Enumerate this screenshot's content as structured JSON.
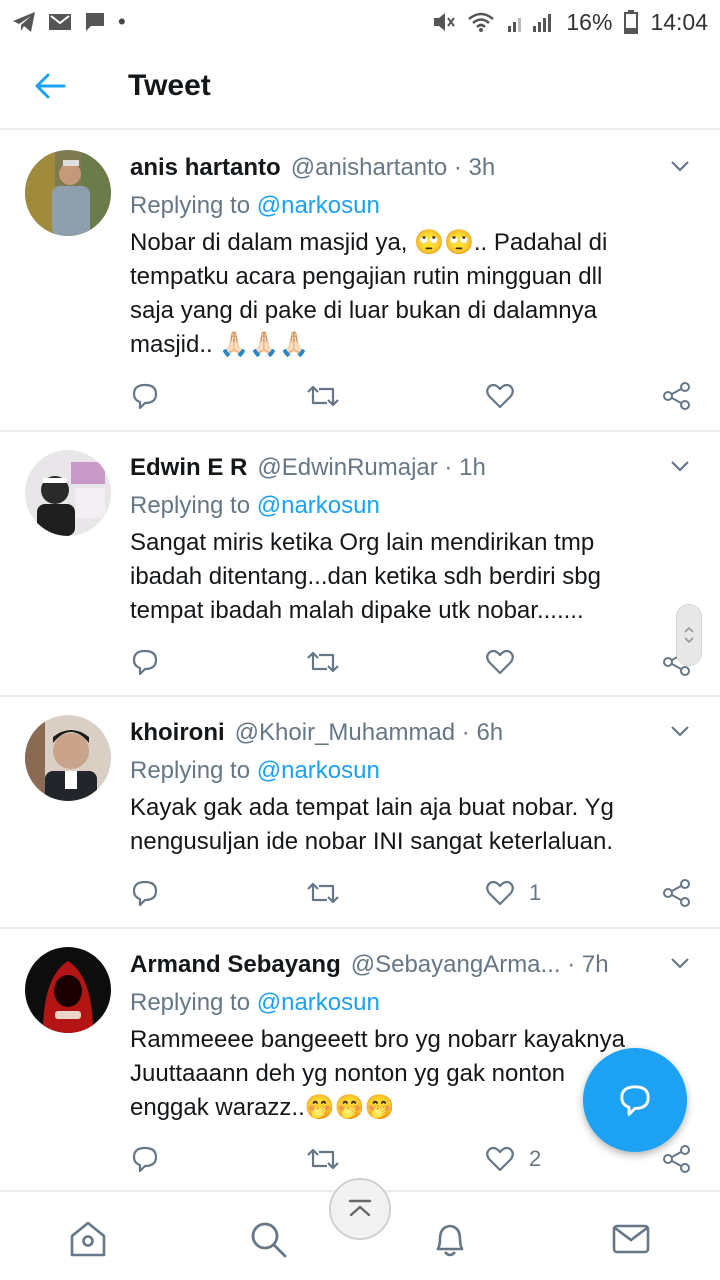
{
  "status_bar": {
    "battery": "16%",
    "time": "14:04"
  },
  "header": {
    "title": "Tweet"
  },
  "tweets": [
    {
      "name": "anis hartanto",
      "handle": "@anishartanto",
      "time": "3h",
      "replying_label": "Replying to",
      "replying_to": "@narkosun",
      "lines": [
        "Nobar di dalam masjid ya, 🙄🙄.. Padahal di",
        "tempatku acara pengajian rutin mingguan dll",
        "saja yang di pake di luar bukan di dalamnya",
        "masjid.. 🙏🏻🙏🏻🙏🏻"
      ],
      "like_count": ""
    },
    {
      "name": "Edwin E R",
      "handle": "@EdwinRumajar",
      "time": "1h",
      "replying_label": "Replying to",
      "replying_to": "@narkosun",
      "lines": [
        "Sangat miris ketika Org lain mendirikan tmp",
        "ibadah ditentang...dan ketika sdh berdiri sbg",
        "tempat ibadah malah dipake utk nobar......."
      ],
      "like_count": ""
    },
    {
      "name": "khoironi",
      "handle": "@Khoir_Muhammad",
      "time": "6h",
      "replying_label": "Replying to",
      "replying_to": "@narkosun",
      "lines": [
        "Kayak gak ada tempat lain aja buat nobar. Yg",
        "nengusuljan ide nobar INI sangat keterlaluan."
      ],
      "like_count": "1"
    },
    {
      "name": "Armand Sebayang",
      "handle": "@SebayangArma...",
      "time": "7h",
      "replying_label": "Replying to",
      "replying_to": "@narkosun",
      "lines": [
        "Rammeeee bangeeett bro yg nobarr kayaknya",
        "Juuttaaann deh yg nonton yg gak nonton",
        "enggak warazz..🤭🤭🤭"
      ],
      "like_count": "2"
    }
  ],
  "nav": [
    "home-icon",
    "search-icon",
    "notifications-icon",
    "messages-icon"
  ],
  "colors": {
    "accent": "#1da1f2",
    "muted": "#657786",
    "text": "#14171a",
    "divider": "#e6ecf0"
  }
}
